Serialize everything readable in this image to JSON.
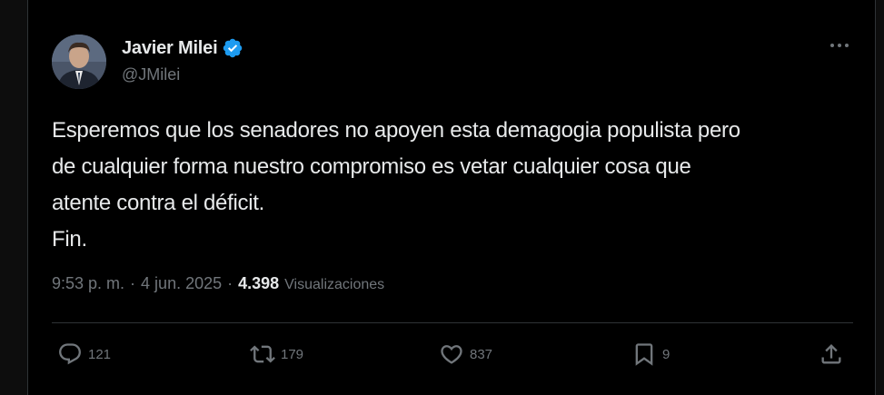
{
  "colors": {
    "background": "#000000",
    "text_primary": "#e7e9ea",
    "text_secondary": "#71767b",
    "divider": "#2f3336",
    "verified_badge": "#1d9bf0"
  },
  "author": {
    "display_name": "Javier Milei",
    "handle": "@JMilei",
    "verified_icon": "verified-badge-icon"
  },
  "tweet": {
    "lines": [
      "Esperemos que los senadores no apoyen esta demagogia populista pero",
      "de cualquier forma nuestro compromiso es vetar cualquier cosa que",
      "atente contra el déficit.",
      "Fin."
    ],
    "time": "9:53 p. m.",
    "separator": "·",
    "date": "4 jun. 2025",
    "views_count": "4.398",
    "views_label": "Visualizaciones"
  },
  "actions": {
    "reply": {
      "icon": "reply-icon",
      "count": "121"
    },
    "retweet": {
      "icon": "retweet-icon",
      "count": "179"
    },
    "like": {
      "icon": "heart-icon",
      "count": "837"
    },
    "bookmark": {
      "icon": "bookmark-icon",
      "count": "9"
    },
    "share": {
      "icon": "share-icon"
    }
  },
  "more_menu": {
    "icon": "more-options-icon"
  }
}
